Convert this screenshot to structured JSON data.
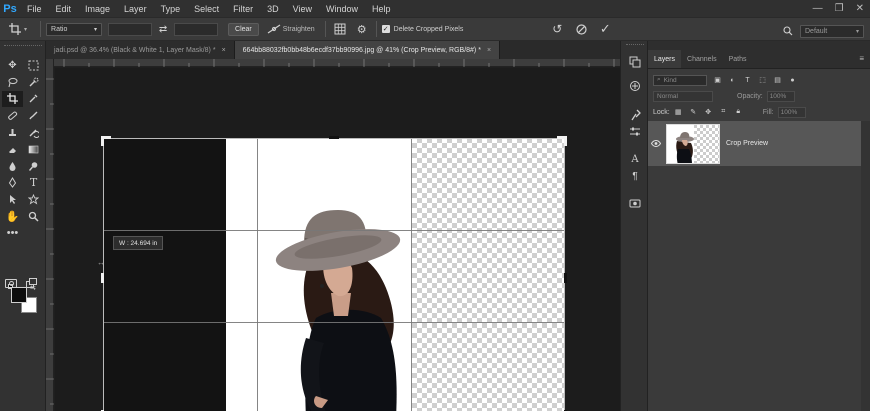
{
  "app": {
    "logo": "Ps"
  },
  "menu": [
    "File",
    "Edit",
    "Image",
    "Layer",
    "Type",
    "Select",
    "Filter",
    "3D",
    "View",
    "Window",
    "Help"
  ],
  "window_controls": {
    "minimize": "—",
    "restore": "❐",
    "close": "✕"
  },
  "options_bar": {
    "ratio_label": "Ratio",
    "clear_label": "Clear",
    "straighten_label": "Straighten",
    "delete_cropped_label": "Delete Cropped Pixels",
    "workspace_label": "Default"
  },
  "tabs": [
    {
      "label": "jadi.psd @ 36.4% (Black & White 1, Layer Mask/8) *",
      "active": false
    },
    {
      "label": "664bb88032fb0bb48b6ecdf37bb90996.jpg @ 41% (Crop Preview, RGB/8#) *",
      "active": true
    }
  ],
  "canvas": {
    "width_readout": "W :  24.694 in"
  },
  "layers_panel": {
    "tabs": [
      "Layers",
      "Channels",
      "Paths"
    ],
    "kind_placeholder": "Kind",
    "blend_mode": "Normal",
    "opacity_label": "Opacity:",
    "opacity_value": "100%",
    "lock_label": "Lock:",
    "fill_label": "Fill:",
    "fill_value": "100%",
    "layers": [
      {
        "name": "Crop Preview",
        "visible": true
      }
    ]
  },
  "colors": {
    "accent": "#31a8ff",
    "panel": "#3a3a3a",
    "canvas_bg": "#1c1c1c"
  }
}
